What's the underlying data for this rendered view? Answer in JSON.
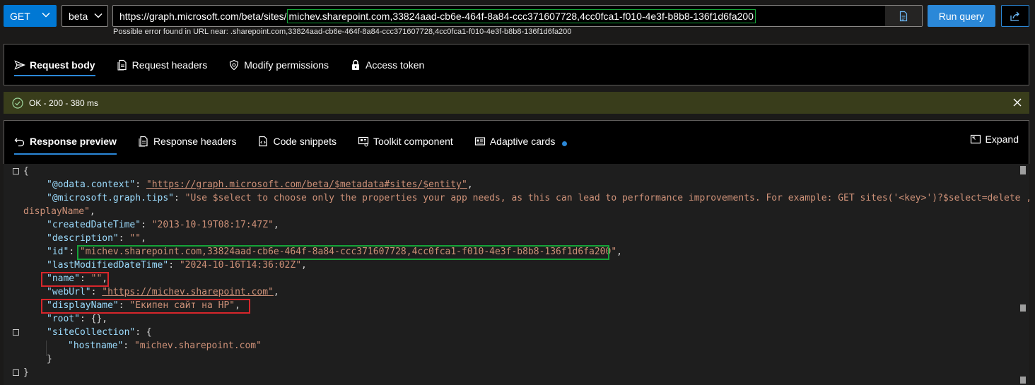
{
  "query": {
    "method": "GET",
    "version": "beta",
    "url_prefix": "https://graph.microsoft.com/beta/sites/",
    "url_highlight": "michev.sharepoint.com,33824aad-cb6e-464f-8a84-ccc371607728,4cc0fca1-f010-4e3f-b8b8-136f1d6fa200",
    "run_label": "Run query",
    "error_text": "Possible error found in URL near: .sharepoint.com,33824aad-cb6e-464f-8a84-ccc371607728,4cc0fca1-f010-4e3f-b8b8-136f1d6fa200"
  },
  "request_tabs": [
    {
      "label": "Request body",
      "icon": "send-icon"
    },
    {
      "label": "Request headers",
      "icon": "document-icon"
    },
    {
      "label": "Modify permissions",
      "icon": "shield-icon"
    },
    {
      "label": "Access token",
      "icon": "lock-icon"
    }
  ],
  "status": {
    "text": "OK - 200 - 380 ms"
  },
  "response_tabs": [
    {
      "label": "Response preview",
      "icon": "undo-icon"
    },
    {
      "label": "Response headers",
      "icon": "document-icon"
    },
    {
      "label": "Code snippets",
      "icon": "code-icon"
    },
    {
      "label": "Toolkit component",
      "icon": "component-icon"
    },
    {
      "label": "Adaptive cards",
      "icon": "card-icon"
    }
  ],
  "expand_label": "Expand",
  "json_lines": {
    "open": "{",
    "context_key": "\"@odata.context\"",
    "context_val": "\"https://graph.microsoft.com/beta/$metadata#sites/$entity\"",
    "tips_key": "\"@microsoft.graph.tips\"",
    "tips_val": "\"Use $select to choose only the properties your app needs, as this can lead to performance improvements. For example: GET sites('<key>')?$select=deleted,",
    "tips_val2": "displayName\"",
    "created_key": "\"createdDateTime\"",
    "created_val": "\"2013-10-19T08:17:47Z\"",
    "desc_key": "\"description\"",
    "desc_val": "\"\"",
    "id_key": "\"id\"",
    "id_val": "\"michev.sharepoint.com,33824aad-cb6e-464f-8a84-ccc371607728,4cc0fca1-f010-4e3f-b8b8-136f1d6fa200\"",
    "modified_key": "\"lastModifiedDateTime\"",
    "modified_val": "\"2024-10-16T14:36:02Z\"",
    "name_key": "\"name\"",
    "name_val": "\"\"",
    "weburl_key": "\"webUrl\"",
    "weburl_val": "\"https://michev.sharepoint.com\"",
    "display_key": "\"displayName\"",
    "display_val": "\"Екипен сайт на НР\"",
    "root_key": "\"root\"",
    "root_val": "{}",
    "sitecoll_key": "\"siteCollection\"",
    "hostname_key": "\"hostname\"",
    "hostname_val": "\"michev.sharepoint.com\"",
    "close_inner": "}",
    "close": "}"
  }
}
